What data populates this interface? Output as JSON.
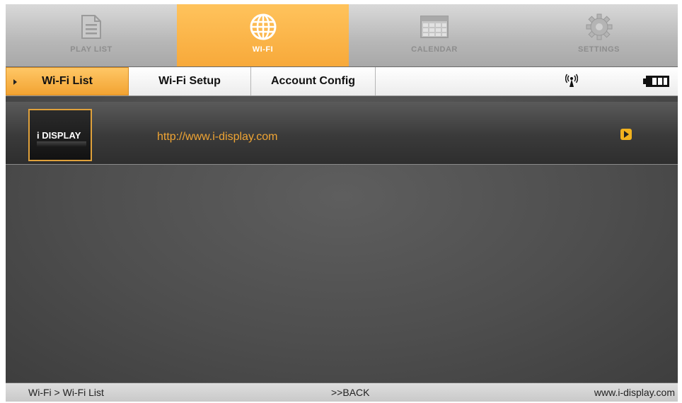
{
  "nav": {
    "items": [
      {
        "label": "PLAY LIST",
        "icon": "playlist-icon"
      },
      {
        "label": "WI-FI",
        "icon": "globe-icon"
      },
      {
        "label": "CALENDAR",
        "icon": "calendar-icon"
      },
      {
        "label": "SETTINGS",
        "icon": "gear-icon"
      }
    ],
    "active_index": 1
  },
  "subtabs": [
    "Wi-Fi List",
    "Wi-Fi Setup",
    "Account Config"
  ],
  "list": {
    "items": [
      {
        "logo_text": "i DISPLAY",
        "url": "http://www.i-display.com"
      }
    ]
  },
  "footer": {
    "breadcrumb": "Wi-Fi > Wi-Fi List",
    "back": ">>BACK",
    "site": "www.i-display.com"
  },
  "colors": {
    "accent": "#f7a93a",
    "link": "#f0a534",
    "background": "#4e4e4e"
  }
}
